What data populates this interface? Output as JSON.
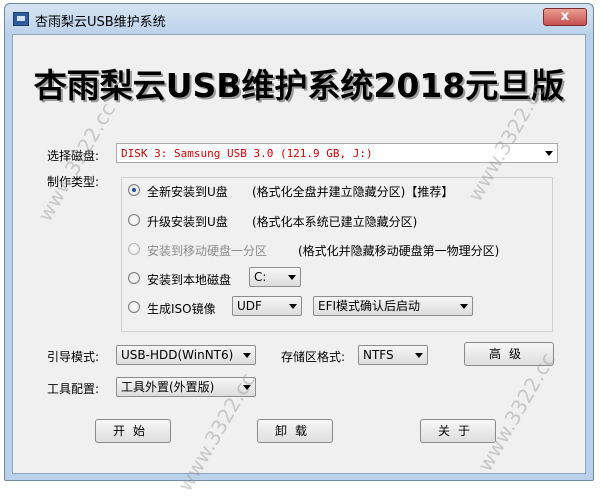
{
  "window": {
    "title": "杏雨梨云USB维护系统",
    "close_label": "x"
  },
  "banner": "杏雨梨云USB维护系统2018元旦版",
  "disk": {
    "label": "选择磁盘:",
    "value": "DISK 3: Samsung USB 3.0 (121.9 GB, J:)"
  },
  "mode": {
    "label": "制作类型:",
    "options": [
      {
        "label": "全新安装到U盘",
        "desc": "(格式化全盘并建立隐藏分区)【推荐】",
        "checked": true,
        "disabled": false
      },
      {
        "label": "升级安装到U盘",
        "desc": "(格式化本系统已建立隐藏分区)",
        "checked": false,
        "disabled": false
      },
      {
        "label": "安装到移动硬盘一分区",
        "desc": "(格式化并隐藏移动硬盘第一物理分区)",
        "checked": false,
        "disabled": true
      },
      {
        "label": "安装到本地磁盘",
        "combo": "C:",
        "checked": false,
        "disabled": false
      },
      {
        "label": "生成ISO镜像",
        "combo": "UDF",
        "combo2": "EFI模式确认后启动",
        "checked": false,
        "disabled": false
      }
    ]
  },
  "boot": {
    "label": "引导模式:",
    "value": "USB-HDD(WinNT6)"
  },
  "storage": {
    "label": "存储区格式:",
    "value": "NTFS"
  },
  "advanced_button": "高级",
  "tools": {
    "label": "工具配置:",
    "value": "工具外置(外置版)"
  },
  "buttons": {
    "start": "开始",
    "uninstall": "卸载",
    "about": "关于"
  },
  "watermark": "www.3322.cc"
}
